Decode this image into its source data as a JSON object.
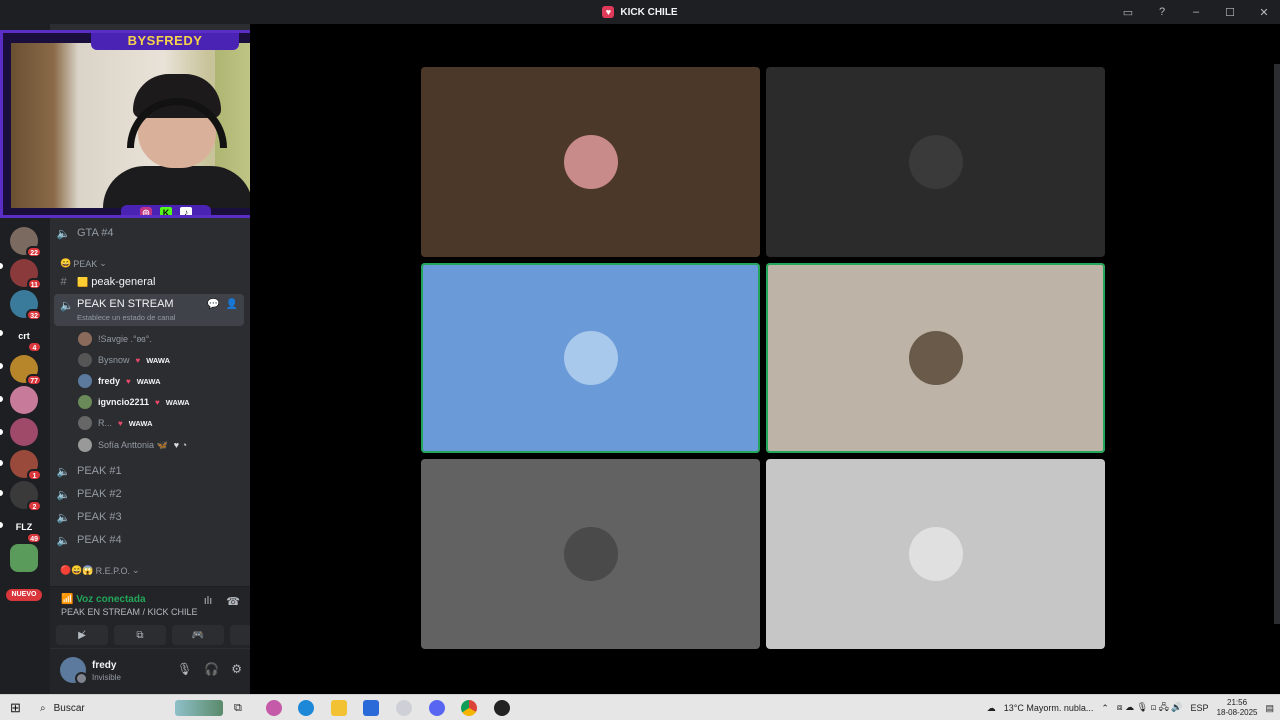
{
  "window": {
    "title": "KICK CHILE",
    "logo_glyph": "♥",
    "controls": [
      "inbox-icon",
      "help-icon",
      "minimize-icon",
      "maximize-icon",
      "close-icon"
    ]
  },
  "stream_overlay": {
    "brand": "BYSFREDY",
    "socials": [
      "instagram-icon",
      "kick-icon",
      "tiktok-icon"
    ],
    "kick_letter": "K"
  },
  "server_rail": {
    "badges": [
      "22",
      "11",
      "32",
      "4",
      "77",
      "1",
      "2",
      "49"
    ],
    "server_texts": [
      "crt",
      "FLZ"
    ],
    "new_label": "NUEVO"
  },
  "sidebar": {
    "channels_top": [
      {
        "label": "GTA #4",
        "type": "voice"
      }
    ],
    "category_peak": "PEAK",
    "peak_general": "peak-general",
    "active_channel": {
      "label": "PEAK EN STREAM",
      "status": "Establece un estado de canal"
    },
    "members": [
      {
        "name": "!Savgie .°ʚɞ°.",
        "tag": "",
        "bold": false,
        "color": "#8a6a5a"
      },
      {
        "name": "Bysnow",
        "tag": "WAWA",
        "bold": false,
        "color": "#555555"
      },
      {
        "name": "fredy",
        "tag": "WAWA",
        "bold": true,
        "color": "#5c7a9e"
      },
      {
        "name": "igvncio2211",
        "tag": "WAWA",
        "bold": true,
        "color": "#6a8a5a"
      },
      {
        "name": "R...",
        "tag": "WAWA",
        "bold": false,
        "color": "#666666"
      },
      {
        "name": "Sofía Anttonia 🦋",
        "tag": "",
        "bold": false,
        "color": "#999999"
      }
    ],
    "channels_bottom": [
      "PEAK #1",
      "PEAK #2",
      "PEAK #3",
      "PEAK #4"
    ],
    "category_repo": "R.E.P.O."
  },
  "voice_panel": {
    "status": "Voz conectada",
    "location": "PEAK EN STREAM / KICK CHILE"
  },
  "user_panel": {
    "name": "fredy",
    "status": "Invisible"
  },
  "tiles": [
    {
      "bg": "#4b3828",
      "avatar_color": "#c98a8a",
      "speaking": false
    },
    {
      "bg": "#2b2b2b",
      "avatar_color": "#3a3a3a",
      "speaking": false
    },
    {
      "bg": "#6a9bd8",
      "avatar_color": "#a8c8ec",
      "speaking": true
    },
    {
      "bg": "#bdb4a7",
      "avatar_color": "#6a5a4a",
      "speaking": true
    },
    {
      "bg": "#626262",
      "avatar_color": "#4a4a4a",
      "speaking": false
    },
    {
      "bg": "#c6c6c6",
      "avatar_color": "#e0e0e0",
      "speaking": false
    }
  ],
  "taskbar": {
    "search_placeholder": "Buscar",
    "weather": "13°C  Mayorm. nubla...",
    "language": "ESP",
    "time": "21:56",
    "date": "18-08-2025"
  }
}
